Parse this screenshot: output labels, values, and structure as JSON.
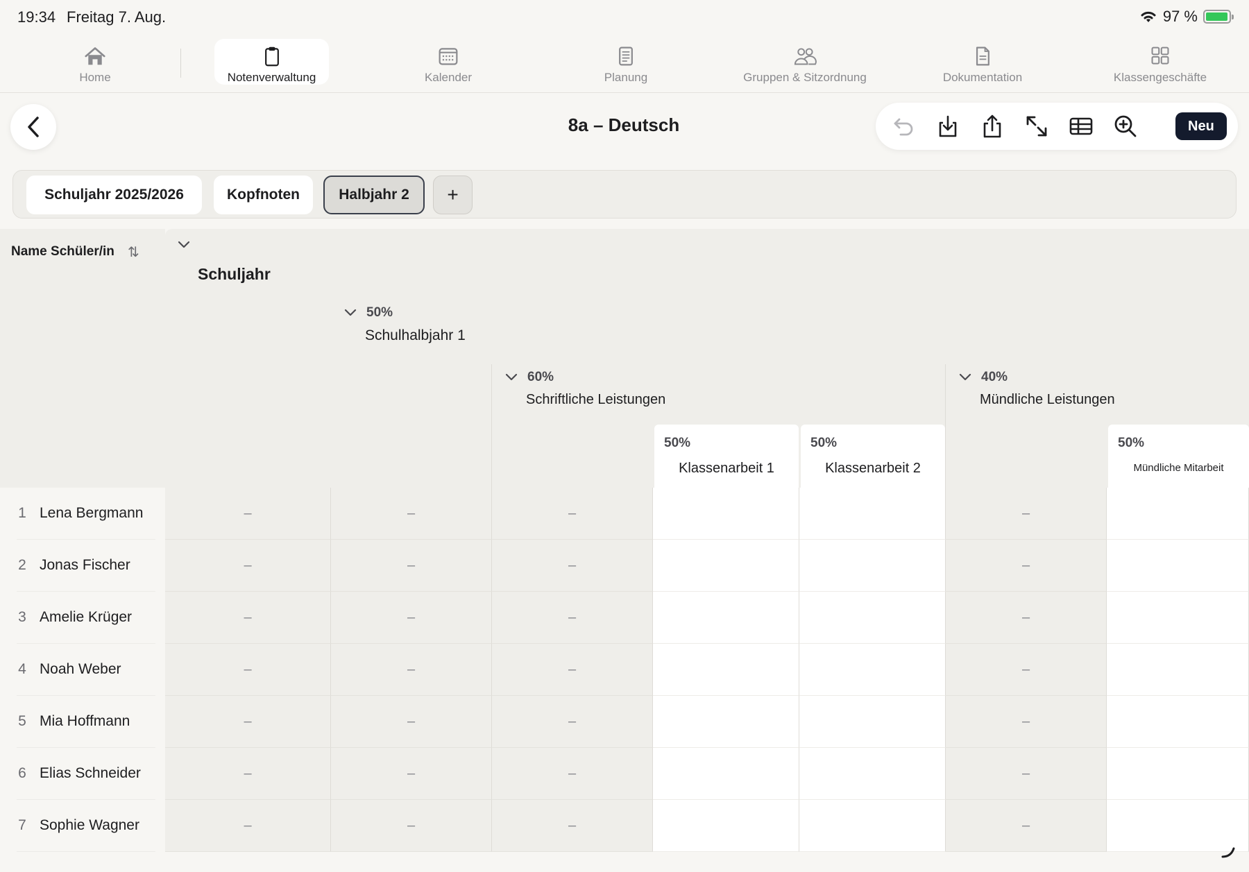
{
  "status": {
    "time": "19:34",
    "date": "Freitag 7. Aug.",
    "battery": "97 %",
    "battery_level": 0.97
  },
  "nav": [
    {
      "label": "Home",
      "icon": "home-icon"
    },
    {
      "label": "Notenverwaltung",
      "icon": "clipboard-icon"
    },
    {
      "label": "Kalender",
      "icon": "calendar-icon"
    },
    {
      "label": "Planung",
      "icon": "notes-icon"
    },
    {
      "label": "Gruppen & Sitzordnung",
      "icon": "people-icon"
    },
    {
      "label": "Dokumentation",
      "icon": "document-icon"
    },
    {
      "label": "Klassengeschäfte",
      "icon": "grid-icon"
    }
  ],
  "header": {
    "title": "8a – Deutsch",
    "new_label": "Neu"
  },
  "toolbar_icons": [
    "undo-icon",
    "download-icon",
    "share-icon",
    "expand-icon",
    "table-icon",
    "zoom-icon"
  ],
  "periods": {
    "tab1": "Schuljahr 2025/2026",
    "tab2": "Kopfnoten",
    "tab3": "Halbjahr 2",
    "add": "+"
  },
  "table": {
    "name_header": "Name Schüler/in",
    "sort_icon": "sort-icon",
    "schuljahr": "Schuljahr",
    "halbjahr1": {
      "pct": "50%",
      "title": "Schulhalbjahr 1"
    },
    "schriftlich": {
      "pct": "60%",
      "title": "Schriftliche Leistungen"
    },
    "muendlich": {
      "pct": "40%",
      "title": "Mündliche Leistungen"
    },
    "ka1": {
      "pct": "50%",
      "title": "Klassenarbeit 1"
    },
    "ka2": {
      "pct": "50%",
      "title": "Klassenarbeit 2"
    },
    "mitarbeit": {
      "pct": "50%",
      "title": "Mündliche Mitarbeit"
    },
    "empty_value": "–",
    "students": [
      {
        "num": "1",
        "name": "Lena Bergmann"
      },
      {
        "num": "2",
        "name": "Jonas Fischer"
      },
      {
        "num": "3",
        "name": "Amelie Krüger"
      },
      {
        "num": "4",
        "name": "Noah Weber"
      },
      {
        "num": "5",
        "name": "Mia Hoffmann"
      },
      {
        "num": "6",
        "name": "Elias Schneider"
      },
      {
        "num": "7",
        "name": "Sophie Wagner"
      }
    ]
  }
}
